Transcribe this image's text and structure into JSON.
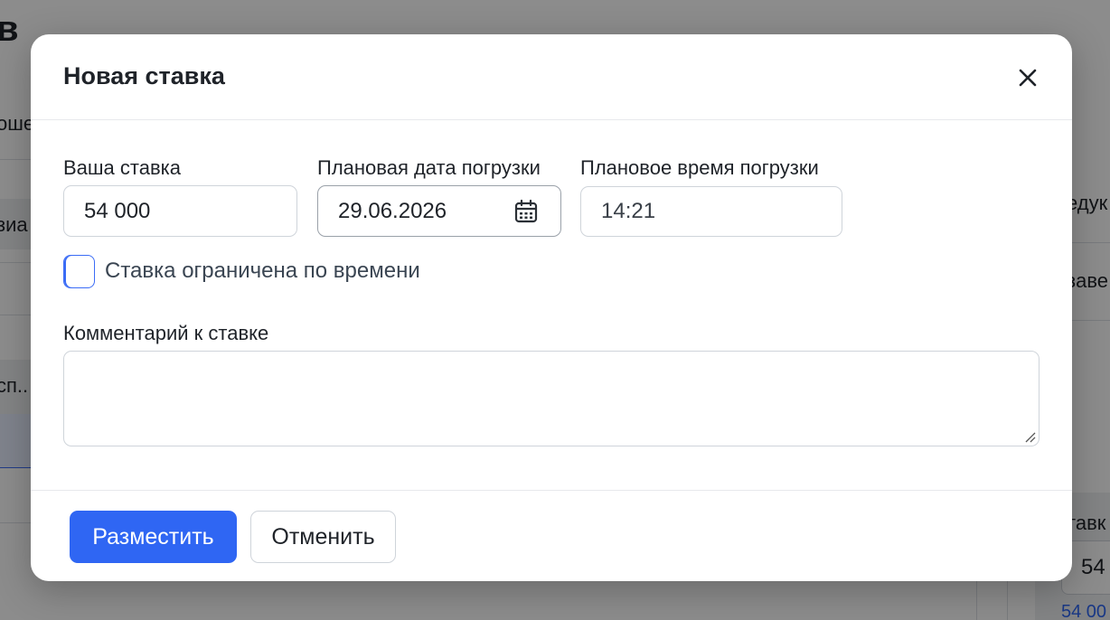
{
  "background": {
    "page_title_fragment": "в",
    "fragments": {
      "left_1": "оше",
      "left_2": "зиа",
      "left_3": "сп..",
      "right_1": "едук",
      "right_2": "заве",
      "right_3": "тавк",
      "right_input": "54",
      "right_link": "54 00"
    }
  },
  "modal": {
    "title": "Новая ставка",
    "fields": {
      "bid": {
        "label": "Ваша ставка",
        "value": "54 000"
      },
      "date": {
        "label": "Плановая дата погрузки",
        "value": "29.06.2026"
      },
      "time": {
        "label": "Плановое время погрузки",
        "value": "14:21"
      }
    },
    "time_limited": {
      "label": "Ставка ограничена по времени",
      "checked": false
    },
    "comment": {
      "label": "Комментарий к ставке",
      "value": ""
    },
    "buttons": {
      "submit": "Разместить",
      "cancel": "Отменить"
    }
  },
  "colors": {
    "accent": "#2f66f3",
    "overlay": "rgba(0,0,0,0.45)"
  }
}
